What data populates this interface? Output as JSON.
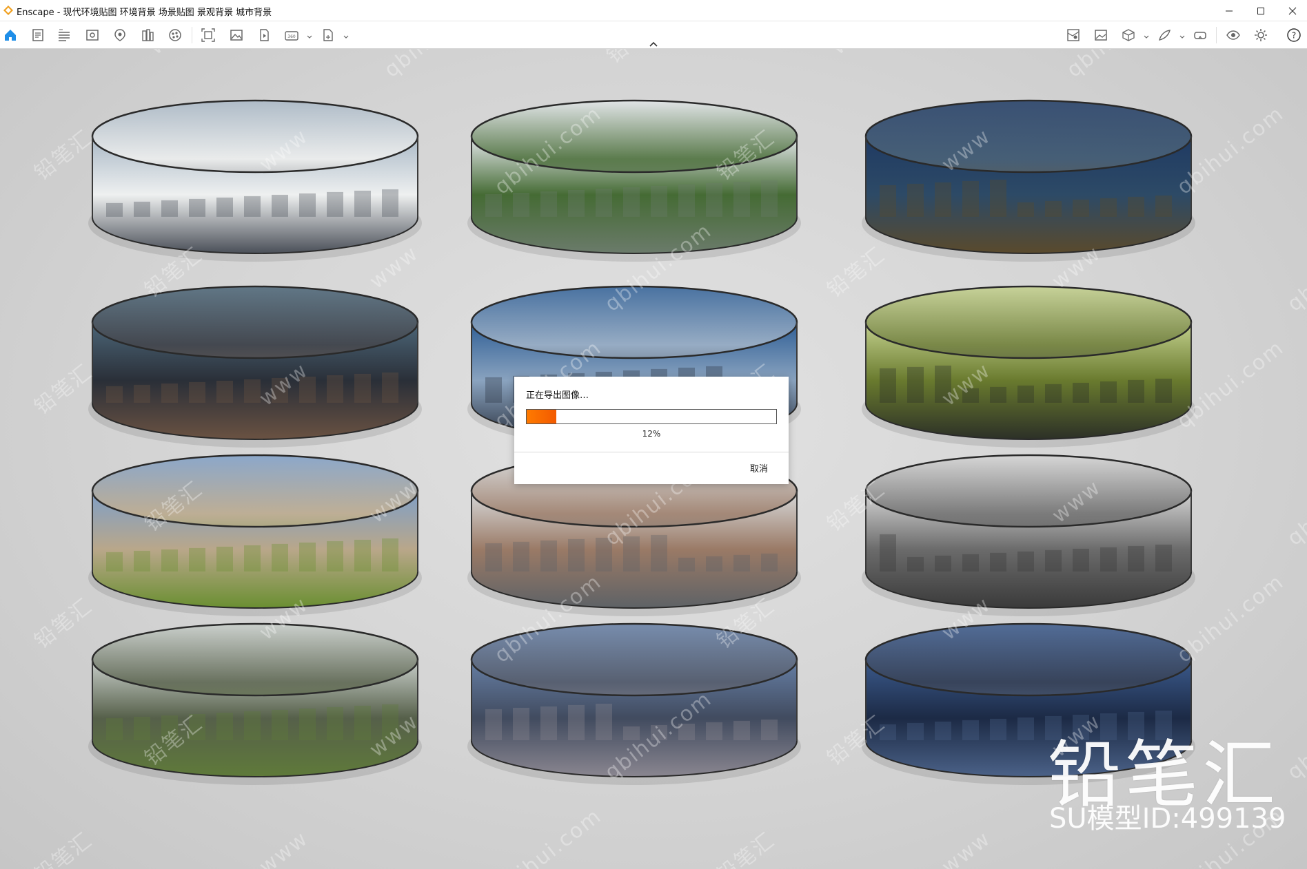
{
  "window": {
    "title": "Enscape - 现代环境贴图 环境背景  场景贴图 景观背景 城市背景"
  },
  "toolbar": {
    "left_icons": [
      "home-icon",
      "project-list-icon",
      "bim-info-icon",
      "visual-settings-icon",
      "views-icon",
      "asset-library-icon",
      "material-editor-icon",
      "render-settings-icon",
      "batch-render-icon",
      "screenshot-icon",
      "video-editor-icon",
      "panorama-icon",
      "export-icon"
    ],
    "right_icons": [
      "minimap-icon",
      "image-gallery-icon",
      "section-box-icon",
      "draw-icon",
      "vr-headset-icon",
      "view-visibility-icon",
      "settings-icon",
      "help-icon"
    ]
  },
  "dialog": {
    "title": "正在导出图像…",
    "progress_value": 0.12,
    "progress_label": "12%",
    "cancel_label": "取消"
  },
  "scene": {
    "rings": [
      {
        "name": "modern-villa-panorama",
        "sky": "#a9b8c6",
        "mid": "#eef0f0",
        "ground": "#4a4f58"
      },
      {
        "name": "residential-garden-panorama",
        "sky": "#e3e7ea",
        "mid": "#456b34",
        "ground": "#6b7b6b"
      },
      {
        "name": "night-city-panorama",
        "sky": "#1f3a63",
        "mid": "#2d4a66",
        "ground": "#5a4a2c"
      },
      {
        "name": "night-skyline-river-panorama",
        "sky": "#4c6678",
        "mid": "#2a2f38",
        "ground": "#6a5242"
      },
      {
        "name": "dusk-horizon-panorama",
        "sky": "#2f5f96",
        "mid": "#8aa3bf",
        "ground": "#2c3442"
      },
      {
        "name": "forest-pavilion-panorama",
        "sky": "#c4d18e",
        "mid": "#697a2e",
        "ground": "#2c3027"
      },
      {
        "name": "countryside-villa-panorama",
        "sky": "#7e9fc8",
        "mid": "#b9a78a",
        "ground": "#6a8f31"
      },
      {
        "name": "canal-town-panorama",
        "sky": "#d8dadb",
        "mid": "#9a7a66",
        "ground": "#5e6266"
      },
      {
        "name": "monochrome-skyline-panorama",
        "sky": "#d6d6d6",
        "mid": "#6b6b6b",
        "ground": "#3a3a3a"
      },
      {
        "name": "pine-garden-villa-panorama",
        "sky": "#c9cfcb",
        "mid": "#56604a",
        "ground": "#5f7a3a"
      },
      {
        "name": "twilight-river-panorama",
        "sky": "#667fa5",
        "mid": "#414b5f",
        "ground": "#8a8690"
      },
      {
        "name": "blue-towers-panorama",
        "sky": "#3b5a8c",
        "mid": "#1c2a45",
        "ground": "#4b6288"
      }
    ]
  },
  "watermark": {
    "brand": "铅笔汇",
    "model_id": "SU模型ID:499139",
    "site": "qbihui.com",
    "tiles": [
      "铅笔汇",
      "www",
      "qbihui.com"
    ]
  }
}
